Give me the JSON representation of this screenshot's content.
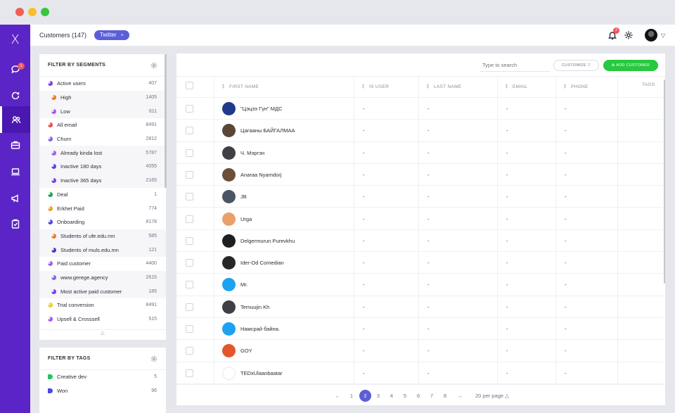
{
  "rail": {
    "logo": "X",
    "notification_count": "1",
    "items": [
      {
        "icon": "chat-icon"
      },
      {
        "icon": "refresh-icon"
      },
      {
        "icon": "users-icon"
      },
      {
        "icon": "briefcase-icon"
      },
      {
        "icon": "laptop-icon"
      },
      {
        "icon": "megaphone-icon"
      },
      {
        "icon": "clipboard-icon"
      }
    ]
  },
  "topbar": {
    "title": "Customers (147)",
    "filter_chip": "Twitter",
    "chip_close": "×",
    "bell_badge": "2"
  },
  "segments": {
    "heading": "FILTER BY SEGMENTS",
    "items": [
      {
        "name": "Active users",
        "count": "407",
        "sub": false,
        "color": "#7c3aed"
      },
      {
        "name": "High",
        "count": "1405",
        "sub": true,
        "color": "#f97316"
      },
      {
        "name": "Low",
        "count": "611",
        "sub": true,
        "color": "#a855f7"
      },
      {
        "name": "All email",
        "count": "8491",
        "sub": false,
        "color": "#ef4444"
      },
      {
        "name": "Churn",
        "count": "2812",
        "sub": false,
        "color": "#8b5cf6"
      },
      {
        "name": "Already kinda lost",
        "count": "5787",
        "sub": true,
        "color": "#a855f7"
      },
      {
        "name": "Inactive 180 days",
        "count": "4055",
        "sub": true,
        "color": "#4f46e5"
      },
      {
        "name": "Inactive 365 days",
        "count": "2165",
        "sub": true,
        "color": "#7c3aed"
      },
      {
        "name": "Deal",
        "count": "1",
        "sub": false,
        "color": "#16a34a"
      },
      {
        "name": "Erkhet Paid",
        "count": "774",
        "sub": false,
        "color": "#f59e0b"
      },
      {
        "name": "Onboarding",
        "count": "8178",
        "sub": false,
        "color": "#4f46e5"
      },
      {
        "name": "Students of ufe.edu.mn",
        "count": "585",
        "sub": true,
        "color": "#f97316"
      },
      {
        "name": "Students of muls.edu.mn",
        "count": "121",
        "sub": true,
        "color": "#4338ca"
      },
      {
        "name": "Paid customer",
        "count": "4400",
        "sub": false,
        "color": "#a855f7"
      },
      {
        "name": "www.gerege.agency",
        "count": "2615",
        "sub": true,
        "color": "#8b5cf6"
      },
      {
        "name": "Most active paid customer",
        "count": "185",
        "sub": true,
        "color": "#7c3aed"
      },
      {
        "name": "Trial conversion",
        "count": "8491",
        "sub": false,
        "color": "#facc15"
      },
      {
        "name": "Upsell & Crosssell",
        "count": "515",
        "sub": false,
        "color": "#a855f7"
      }
    ]
  },
  "tags": {
    "heading": "FILTER BY TAGS",
    "items": [
      {
        "name": "Creative dev",
        "count": "5",
        "color": "#22c55e"
      },
      {
        "name": "Won",
        "count": "96",
        "color": "#4f46e5"
      }
    ]
  },
  "toolbar": {
    "search_placeholder": "Type to search",
    "customize_label": "CUSTOMIZE",
    "add_label": "ADD CUSTOMER"
  },
  "table": {
    "columns": [
      "FIRST NAME",
      "IS USER",
      "LAST NAME",
      "EMAIL",
      "PHONE",
      "TAGS"
    ],
    "rows": [
      {
        "first": "\"Цэцээ Гүн\" МДС",
        "is_user": "-",
        "last": "-",
        "email": "-",
        "phone": "-",
        "avatar_color": "#1e3a8a"
      },
      {
        "first": "Цагааны БАЙГАЛМАА",
        "is_user": "-",
        "last": "-",
        "email": "-",
        "phone": "-",
        "avatar_color": "#5b4636"
      },
      {
        "first": "Ч. Мэргэн",
        "is_user": "-",
        "last": "-",
        "email": "-",
        "phone": "-",
        "avatar_color": "#3f3f46"
      },
      {
        "first": "Anaraa Nyamdorj",
        "is_user": "-",
        "last": "-",
        "email": "-",
        "phone": "-",
        "avatar_color": "#6b4f3a"
      },
      {
        "first": "JB",
        "is_user": "-",
        "last": "-",
        "email": "-",
        "phone": "-",
        "avatar_color": "#4b5563"
      },
      {
        "first": "Urga",
        "is_user": "-",
        "last": "-",
        "email": "-",
        "phone": "-",
        "avatar_color": "#e9a06b"
      },
      {
        "first": "Delgermurun Purevkhu",
        "is_user": "-",
        "last": "-",
        "email": "-",
        "phone": "-",
        "avatar_color": "#1f1f1f"
      },
      {
        "first": "Ider-Od Comedian",
        "is_user": "-",
        "last": "-",
        "email": "-",
        "phone": "-",
        "avatar_color": "#27272a"
      },
      {
        "first": "Mr.",
        "is_user": "-",
        "last": "-",
        "email": "-",
        "phone": "-",
        "avatar_color": "#1da1f2"
      },
      {
        "first": "Temuujin Kh",
        "is_user": "-",
        "last": "-",
        "email": "-",
        "phone": "-",
        "avatar_color": "#3f3f46"
      },
      {
        "first": "Намсрай байна.",
        "is_user": "-",
        "last": "-",
        "email": "-",
        "phone": "-",
        "avatar_color": "#1da1f2"
      },
      {
        "first": "GOY",
        "is_user": "-",
        "last": "-",
        "email": "-",
        "phone": "-",
        "avatar_color": "#e2572b"
      },
      {
        "first": "TEDxUlaanbaatar",
        "is_user": "-",
        "last": "-",
        "email": "-",
        "phone": "-",
        "avatar_color": "#ffffff"
      }
    ]
  },
  "pagination": {
    "prev": "←",
    "next": "→",
    "pages": [
      "1",
      "2",
      "3",
      "4",
      "5",
      "6",
      "7",
      "8"
    ],
    "current": "2",
    "per_page": "20 per page"
  }
}
